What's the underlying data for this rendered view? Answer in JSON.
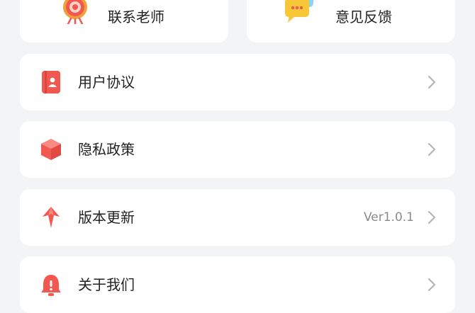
{
  "top_actions": {
    "contact_teacher": {
      "label": "联系老师",
      "icon": "lantern-icon"
    },
    "feedback": {
      "label": "意见反馈",
      "icon": "chat-bubble-icon"
    }
  },
  "menu": {
    "user_agreement": {
      "label": "用户协议",
      "icon": "document-icon"
    },
    "privacy_policy": {
      "label": "隐私政策",
      "icon": "box-icon"
    },
    "version_update": {
      "label": "版本更新",
      "value": "Ver1.0.1",
      "icon": "rocket-icon"
    },
    "about_us": {
      "label": "关于我们",
      "icon": "bell-icon"
    }
  },
  "colors": {
    "accent": "#f1584f",
    "background": "#f3f4f6",
    "card": "#ffffff",
    "text": "#222222",
    "muted": "#8a8a8a",
    "chevron": "#b5b5b5"
  }
}
